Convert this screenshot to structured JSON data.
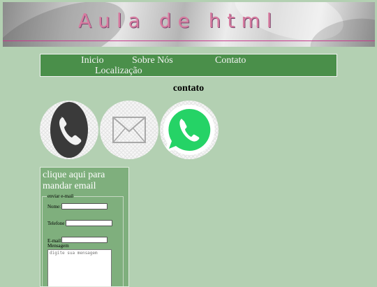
{
  "banner": {
    "title": "Aula de html"
  },
  "nav": {
    "items": [
      {
        "label": "Inicio"
      },
      {
        "label": "Sobre Nós"
      },
      {
        "label": "Contato"
      },
      {
        "label": "Localização"
      }
    ]
  },
  "main": {
    "heading": "contato"
  },
  "contact_icons": [
    {
      "icon": "phone-icon"
    },
    {
      "icon": "envelope-icon"
    },
    {
      "icon": "whatsapp-icon"
    }
  ],
  "email_panel": {
    "title": "clique aqui para mandar email",
    "legend": "enviar e-mail",
    "fields": {
      "nome": {
        "label": "Nome:",
        "value": ""
      },
      "telefone": {
        "label": "Telefone",
        "value": ""
      },
      "email": {
        "label": "E-mail",
        "value": ""
      },
      "mensagem": {
        "label": "Mensagem",
        "placeholder": "digite sua mensagem"
      }
    }
  },
  "colors": {
    "background": "#b3d0b2",
    "nav": "#4a8f4a",
    "panel": "#7faf7d",
    "banner_text": "#d77ba0",
    "whatsapp": "#25d366"
  }
}
